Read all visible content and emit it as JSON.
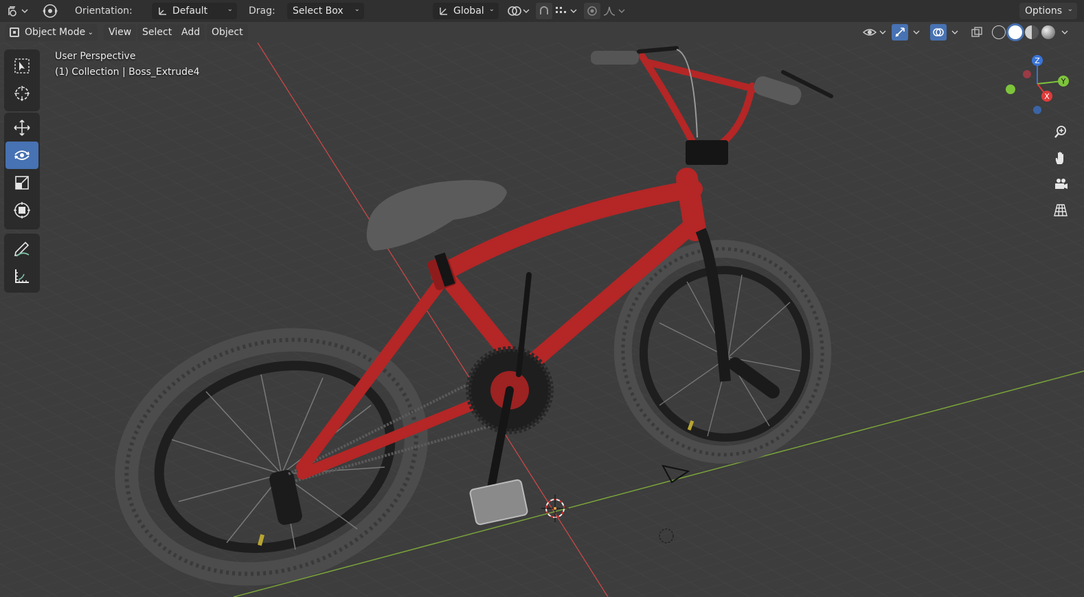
{
  "header": {
    "orientation_label": "Orientation:",
    "orientation_value": "Default",
    "drag_label": "Drag:",
    "drag_value": "Select Box",
    "transform_space": "Global",
    "options_label": "Options"
  },
  "menubar": {
    "mode": "Object Mode",
    "items": [
      "View",
      "Select",
      "Add",
      "Object"
    ]
  },
  "viewport": {
    "perspective": "User Perspective",
    "collection": "(1) Collection | Boss_Extrude4"
  },
  "gizmo": {
    "x": "X",
    "y": "Y",
    "z": "Z"
  },
  "toolbar_icons": [
    "select-box-icon",
    "cursor-icon",
    "move-icon",
    "rotate-icon",
    "scale-icon",
    "transform-icon",
    "annotate-icon",
    "measure-icon"
  ],
  "nav_icons": [
    "zoom-icon",
    "pan-hand-icon",
    "camera-view-icon",
    "ortho-grid-icon"
  ],
  "colors": {
    "accent": "#4772b3",
    "bike_frame": "#b52626",
    "x_axis": "#e03a3a",
    "y_axis": "#7ec43b",
    "z_axis": "#3a74d6"
  }
}
